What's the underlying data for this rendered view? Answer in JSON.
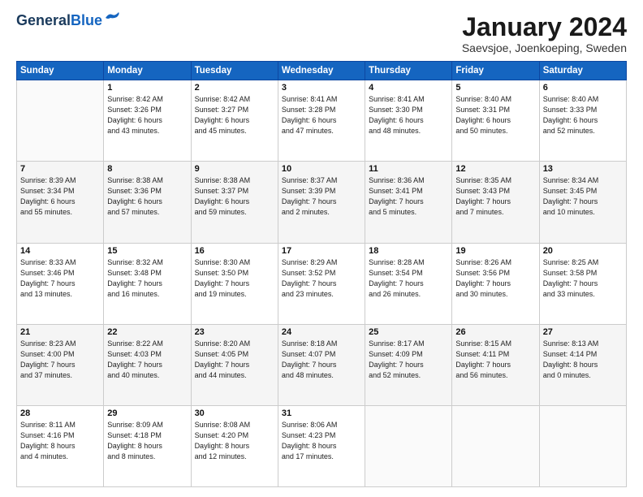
{
  "header": {
    "logo_line1": "General",
    "logo_line2": "Blue",
    "month_title": "January 2024",
    "subtitle": "Saevsjoe, Joenkoeping, Sweden"
  },
  "days_of_week": [
    "Sunday",
    "Monday",
    "Tuesday",
    "Wednesday",
    "Thursday",
    "Friday",
    "Saturday"
  ],
  "weeks": [
    [
      {
        "day": "",
        "info": ""
      },
      {
        "day": "1",
        "info": "Sunrise: 8:42 AM\nSunset: 3:26 PM\nDaylight: 6 hours\nand 43 minutes."
      },
      {
        "day": "2",
        "info": "Sunrise: 8:42 AM\nSunset: 3:27 PM\nDaylight: 6 hours\nand 45 minutes."
      },
      {
        "day": "3",
        "info": "Sunrise: 8:41 AM\nSunset: 3:28 PM\nDaylight: 6 hours\nand 47 minutes."
      },
      {
        "day": "4",
        "info": "Sunrise: 8:41 AM\nSunset: 3:30 PM\nDaylight: 6 hours\nand 48 minutes."
      },
      {
        "day": "5",
        "info": "Sunrise: 8:40 AM\nSunset: 3:31 PM\nDaylight: 6 hours\nand 50 minutes."
      },
      {
        "day": "6",
        "info": "Sunrise: 8:40 AM\nSunset: 3:33 PM\nDaylight: 6 hours\nand 52 minutes."
      }
    ],
    [
      {
        "day": "7",
        "info": "Sunrise: 8:39 AM\nSunset: 3:34 PM\nDaylight: 6 hours\nand 55 minutes."
      },
      {
        "day": "8",
        "info": "Sunrise: 8:38 AM\nSunset: 3:36 PM\nDaylight: 6 hours\nand 57 minutes."
      },
      {
        "day": "9",
        "info": "Sunrise: 8:38 AM\nSunset: 3:37 PM\nDaylight: 6 hours\nand 59 minutes."
      },
      {
        "day": "10",
        "info": "Sunrise: 8:37 AM\nSunset: 3:39 PM\nDaylight: 7 hours\nand 2 minutes."
      },
      {
        "day": "11",
        "info": "Sunrise: 8:36 AM\nSunset: 3:41 PM\nDaylight: 7 hours\nand 5 minutes."
      },
      {
        "day": "12",
        "info": "Sunrise: 8:35 AM\nSunset: 3:43 PM\nDaylight: 7 hours\nand 7 minutes."
      },
      {
        "day": "13",
        "info": "Sunrise: 8:34 AM\nSunset: 3:45 PM\nDaylight: 7 hours\nand 10 minutes."
      }
    ],
    [
      {
        "day": "14",
        "info": "Sunrise: 8:33 AM\nSunset: 3:46 PM\nDaylight: 7 hours\nand 13 minutes."
      },
      {
        "day": "15",
        "info": "Sunrise: 8:32 AM\nSunset: 3:48 PM\nDaylight: 7 hours\nand 16 minutes."
      },
      {
        "day": "16",
        "info": "Sunrise: 8:30 AM\nSunset: 3:50 PM\nDaylight: 7 hours\nand 19 minutes."
      },
      {
        "day": "17",
        "info": "Sunrise: 8:29 AM\nSunset: 3:52 PM\nDaylight: 7 hours\nand 23 minutes."
      },
      {
        "day": "18",
        "info": "Sunrise: 8:28 AM\nSunset: 3:54 PM\nDaylight: 7 hours\nand 26 minutes."
      },
      {
        "day": "19",
        "info": "Sunrise: 8:26 AM\nSunset: 3:56 PM\nDaylight: 7 hours\nand 30 minutes."
      },
      {
        "day": "20",
        "info": "Sunrise: 8:25 AM\nSunset: 3:58 PM\nDaylight: 7 hours\nand 33 minutes."
      }
    ],
    [
      {
        "day": "21",
        "info": "Sunrise: 8:23 AM\nSunset: 4:00 PM\nDaylight: 7 hours\nand 37 minutes."
      },
      {
        "day": "22",
        "info": "Sunrise: 8:22 AM\nSunset: 4:03 PM\nDaylight: 7 hours\nand 40 minutes."
      },
      {
        "day": "23",
        "info": "Sunrise: 8:20 AM\nSunset: 4:05 PM\nDaylight: 7 hours\nand 44 minutes."
      },
      {
        "day": "24",
        "info": "Sunrise: 8:18 AM\nSunset: 4:07 PM\nDaylight: 7 hours\nand 48 minutes."
      },
      {
        "day": "25",
        "info": "Sunrise: 8:17 AM\nSunset: 4:09 PM\nDaylight: 7 hours\nand 52 minutes."
      },
      {
        "day": "26",
        "info": "Sunrise: 8:15 AM\nSunset: 4:11 PM\nDaylight: 7 hours\nand 56 minutes."
      },
      {
        "day": "27",
        "info": "Sunrise: 8:13 AM\nSunset: 4:14 PM\nDaylight: 8 hours\nand 0 minutes."
      }
    ],
    [
      {
        "day": "28",
        "info": "Sunrise: 8:11 AM\nSunset: 4:16 PM\nDaylight: 8 hours\nand 4 minutes."
      },
      {
        "day": "29",
        "info": "Sunrise: 8:09 AM\nSunset: 4:18 PM\nDaylight: 8 hours\nand 8 minutes."
      },
      {
        "day": "30",
        "info": "Sunrise: 8:08 AM\nSunset: 4:20 PM\nDaylight: 8 hours\nand 12 minutes."
      },
      {
        "day": "31",
        "info": "Sunrise: 8:06 AM\nSunset: 4:23 PM\nDaylight: 8 hours\nand 17 minutes."
      },
      {
        "day": "",
        "info": ""
      },
      {
        "day": "",
        "info": ""
      },
      {
        "day": "",
        "info": ""
      }
    ]
  ]
}
